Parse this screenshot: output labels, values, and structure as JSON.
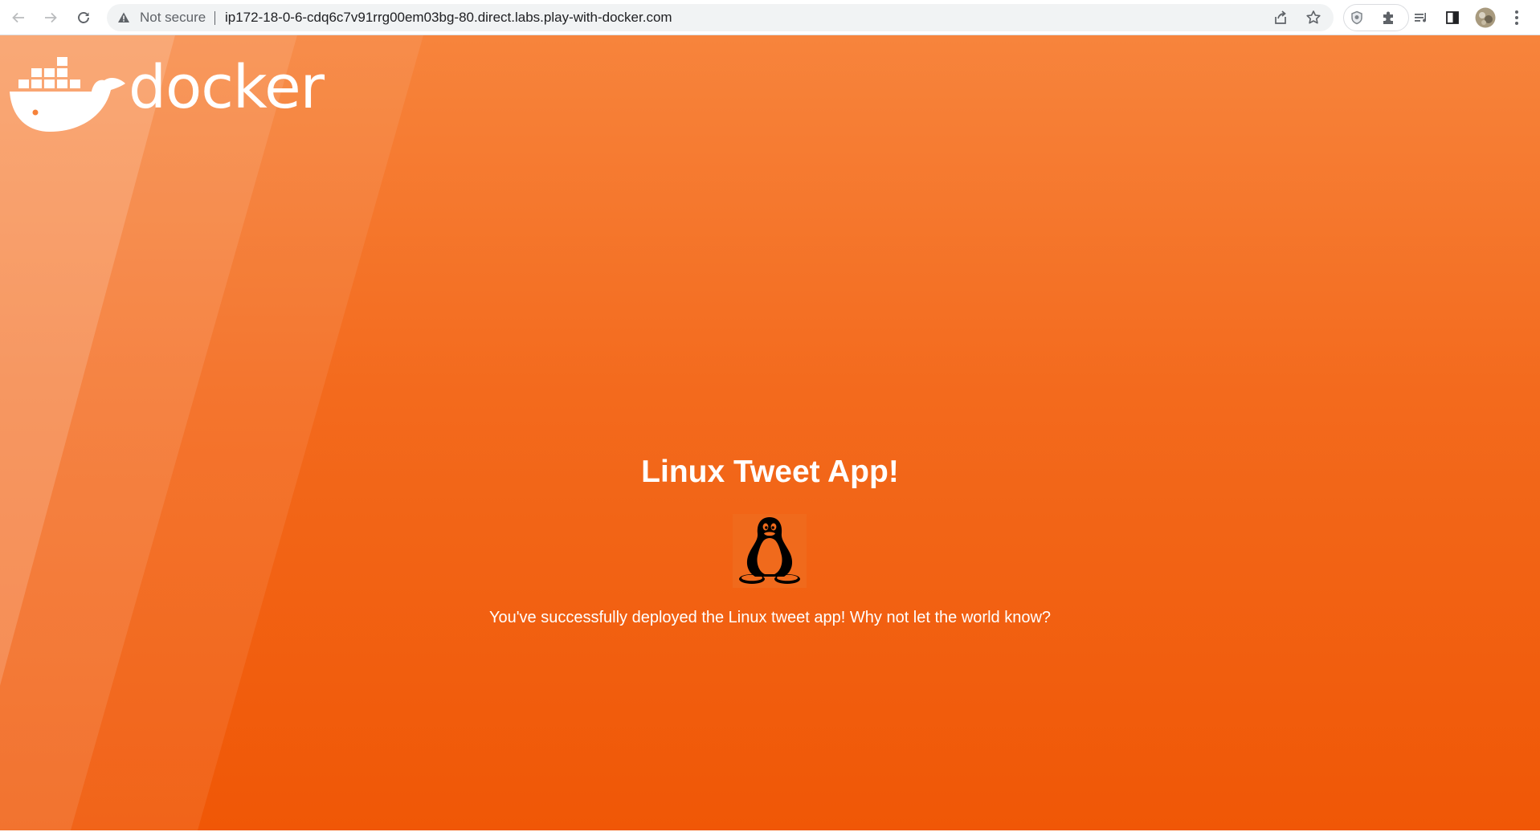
{
  "browser": {
    "security_label": "Not secure",
    "url": "ip172-18-0-6-cdq6c7v91rrg00em03bg-80.direct.labs.play-with-docker.com",
    "icons": {
      "back": "arrow-left-icon",
      "forward": "arrow-right-icon",
      "reload": "reload-icon",
      "warning": "warning-triangle-icon",
      "share": "share-icon",
      "bookmark": "star-icon",
      "extension_shield": "shield-icon",
      "extensions": "puzzle-icon",
      "reading_list": "reading-list-icon",
      "side_panel": "side-panel-icon",
      "profile": "avatar",
      "menu": "kebab-menu-icon"
    }
  },
  "page": {
    "logo_text": "docker",
    "title": "Linux Tweet App!",
    "message": "You've successfully deployed the Linux tweet app! Why not let the world know?",
    "image": "tux-penguin",
    "colors": {
      "background_top": "#f7843c",
      "background_bottom": "#f05706",
      "text": "#ffffff"
    }
  }
}
